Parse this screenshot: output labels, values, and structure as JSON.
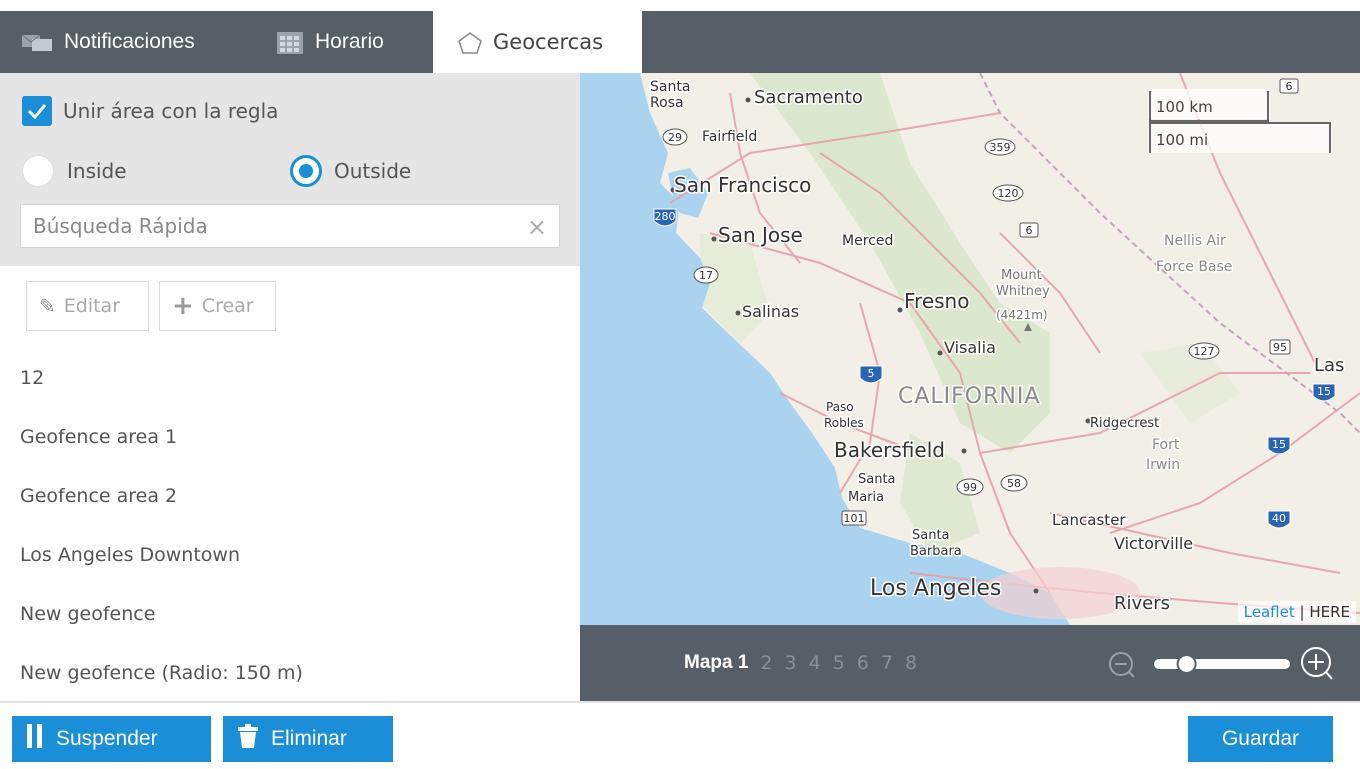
{
  "tabs": [
    {
      "label": "Notificaciones",
      "icon": "notifications-icon"
    },
    {
      "label": "Horario",
      "icon": "calendar-icon"
    },
    {
      "label": "Geocercas",
      "icon": "pentagon-icon"
    }
  ],
  "rules": {
    "unir_label": "Unir área con la regla",
    "unir_checked": true,
    "inside_label": "Inside",
    "outside_label": "Outside",
    "selected": "Outside",
    "search_placeholder": "Búsqueda Rápida",
    "clear_glyph": "×"
  },
  "toolbar": {
    "edit_label": "Editar",
    "create_label": "Crear"
  },
  "geofences": [
    "12",
    "Geofence area 1",
    "Geofence area 2",
    "Los Angeles Downtown",
    "New geofence",
    "New geofence (Radio: 150 m)"
  ],
  "map": {
    "scale_km": "100 km",
    "scale_mi": "100 mi",
    "attribution_leaflet": "Leaflet",
    "attribution_sep": " | ",
    "attribution_here": "HERE",
    "labels": {
      "santa_rosa_1": "Santa",
      "santa_rosa_2": "Rosa",
      "sacramento": "Sacramento",
      "fairfield": "Fairfield",
      "san_francisco": "San Francisco",
      "san_jose": "San Jose",
      "merced": "Merced",
      "nellis_1": "Nellis Air",
      "nellis_2": "Force Base",
      "mount_1": "Mount",
      "mount_2": "Whitney",
      "mount_3": "(4421m)",
      "fresno": "Fresno",
      "salinas": "Salinas",
      "visalia": "Visalia",
      "las": "Las",
      "california": "CALIFORNIA",
      "paso_1": "Paso",
      "paso_2": "Robles",
      "ridgecrest": "Ridgecrest",
      "fort_1": "Fort",
      "fort_2": "Irwin",
      "bakersfield": "Bakersfield",
      "santa_maria_1": "Santa",
      "santa_maria_2": "Maria",
      "lancaster": "Lancaster",
      "santa_barbara_1": "Santa",
      "santa_barbara_2": "Barbara",
      "victorville": "Victorville",
      "los_angeles": "Los Angeles",
      "riverside": "Rivers"
    },
    "shields": [
      "6",
      "29",
      "359",
      "120",
      "280",
      "6",
      "17",
      "127",
      "95",
      "5",
      "15",
      "15",
      "99",
      "58",
      "101",
      "40"
    ]
  },
  "pager": {
    "active": "Mapa 1",
    "pages": [
      "2",
      "3",
      "4",
      "5",
      "6",
      "7",
      "8"
    ]
  },
  "zoom": {
    "level": 0.2
  },
  "footer": {
    "suspend_label": "Suspender",
    "delete_label": "Eliminar",
    "save_label": "Guardar"
  },
  "colors": {
    "accent": "#1a8fd8",
    "tabbar": "#565e67",
    "panel": "#e5e5e5",
    "ocean": "#aad3ef",
    "land": "#f1efe6"
  }
}
